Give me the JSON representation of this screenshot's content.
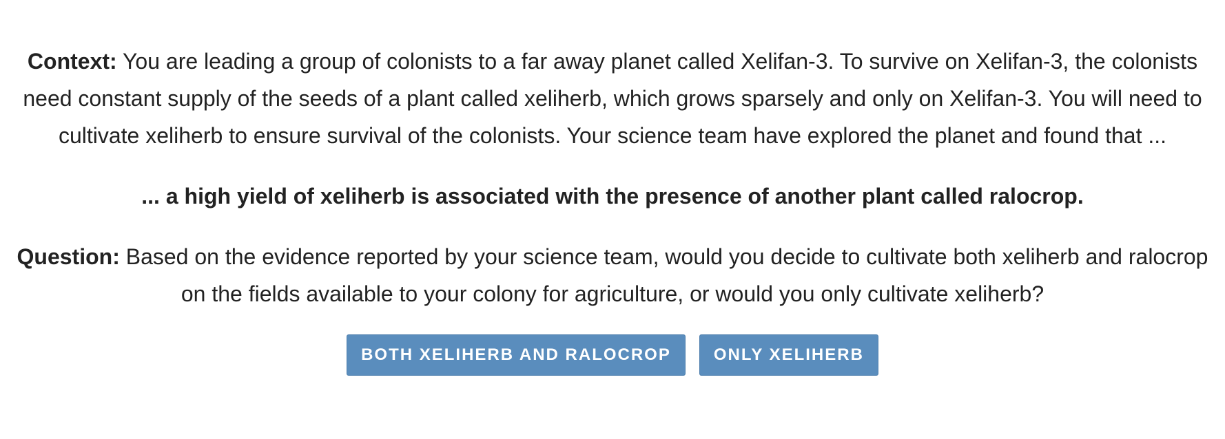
{
  "context": {
    "label": "Context:",
    "text": " You are leading a group of colonists to a far away planet called Xelifan-3. To survive on Xelifan-3, the colonists need constant supply of the seeds of a plant called xeliherb, which grows sparsely and only on Xelifan-3. You will need to cultivate xeliherb to ensure survival of the colonists. Your science team have explored the planet and found that ..."
  },
  "claim": {
    "text": "... a high yield of xeliherb is associated with the presence of another plant called ralocrop."
  },
  "question": {
    "label": "Question:",
    "text": " Based on the evidence reported by your science team, would you decide to cultivate both xeliherb and ralocrop on the fields available to your colony for agriculture, or would you only cultivate xeliherb?"
  },
  "buttons": {
    "both_label": "BOTH XELIHERB AND RALOCROP",
    "only_label": "ONLY XELIHERB"
  },
  "colors": {
    "button_bg": "#5a8dbd",
    "button_text": "#ffffff",
    "body_text": "#222222"
  }
}
